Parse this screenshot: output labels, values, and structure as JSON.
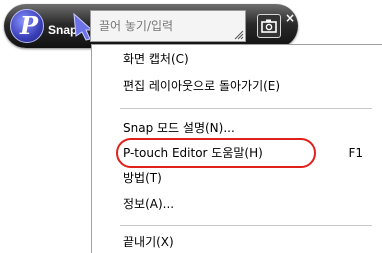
{
  "toolbar": {
    "logo_letter": "P",
    "mode_label": "Snap",
    "input": {
      "placeholder": "끌어 놓기/입력",
      "value": ""
    },
    "close_symbol": "×",
    "icons": [
      "snap-logo-icon",
      "drag-arrow-icon",
      "resize-grip-icon",
      "camera-icon",
      "close-icon"
    ],
    "colors": {
      "bar": "#1f1f1f",
      "logo": "#3a3fb8",
      "highlight": "#e0201b"
    }
  },
  "menu": {
    "items": [
      {
        "label": "화면 캡처(C)",
        "shortcut": ""
      },
      {
        "label": "편집 레이아웃으로 돌아가기(E)",
        "shortcut": ""
      },
      {
        "label": "Snap 모드 설명(N)...",
        "shortcut": ""
      },
      {
        "label": "P-touch Editor 도움말(H)",
        "shortcut": "F1",
        "highlighted": true
      },
      {
        "label": "방법(T)",
        "shortcut": ""
      },
      {
        "label": "정보(A)...",
        "shortcut": ""
      },
      {
        "label": "끝내기(X)",
        "shortcut": ""
      }
    ]
  }
}
